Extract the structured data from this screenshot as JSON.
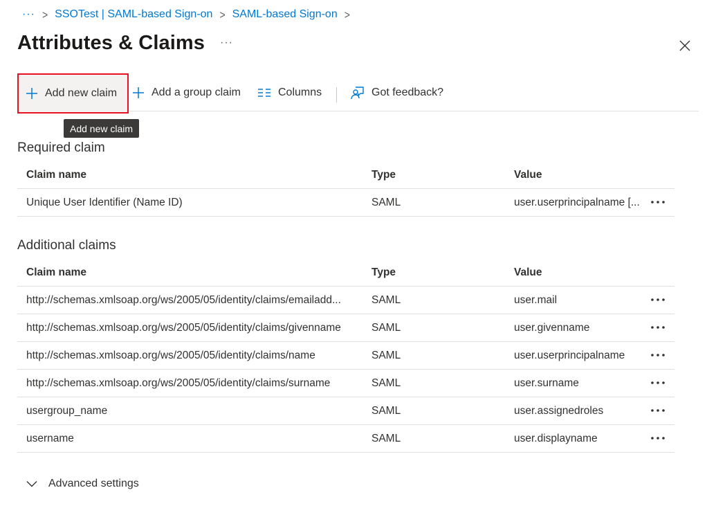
{
  "breadcrumb": {
    "ellipsis": "···",
    "items": [
      "SSOTest | SAML-based Sign-on",
      "SAML-based Sign-on"
    ],
    "separator": ">"
  },
  "header": {
    "title": "Attributes & Claims",
    "more": "···"
  },
  "toolbar": {
    "add_claim": "Add new claim",
    "add_group_claim": "Add a group claim",
    "columns": "Columns",
    "feedback": "Got feedback?"
  },
  "tooltip": "Add new claim",
  "columns": {
    "name": "Claim name",
    "type": "Type",
    "value": "Value"
  },
  "required": {
    "title": "Required claim",
    "rows": [
      {
        "name": "Unique User Identifier (Name ID)",
        "type": "SAML",
        "value": "user.userprincipalname [..."
      }
    ]
  },
  "additional": {
    "title": "Additional claims",
    "rows": [
      {
        "name": "http://schemas.xmlsoap.org/ws/2005/05/identity/claims/emailadd...",
        "type": "SAML",
        "value": "user.mail"
      },
      {
        "name": "http://schemas.xmlsoap.org/ws/2005/05/identity/claims/givenname",
        "type": "SAML",
        "value": "user.givenname"
      },
      {
        "name": "http://schemas.xmlsoap.org/ws/2005/05/identity/claims/name",
        "type": "SAML",
        "value": "user.userprincipalname"
      },
      {
        "name": "http://schemas.xmlsoap.org/ws/2005/05/identity/claims/surname",
        "type": "SAML",
        "value": "user.surname"
      },
      {
        "name": "usergroup_name",
        "type": "SAML",
        "value": "user.assignedroles"
      },
      {
        "name": "username",
        "type": "SAML",
        "value": "user.displayname"
      }
    ]
  },
  "advanced": {
    "label": "Advanced settings"
  },
  "colors": {
    "accent": "#0078d4",
    "highlight_border": "#e81123",
    "tooltip_bg": "#3b3a39"
  },
  "icons": {
    "add": "plus-icon",
    "columns": "columns-icon",
    "feedback": "feedback-icon",
    "close": "close-icon",
    "more": "more-icon",
    "expand": "chevron-down-icon"
  }
}
